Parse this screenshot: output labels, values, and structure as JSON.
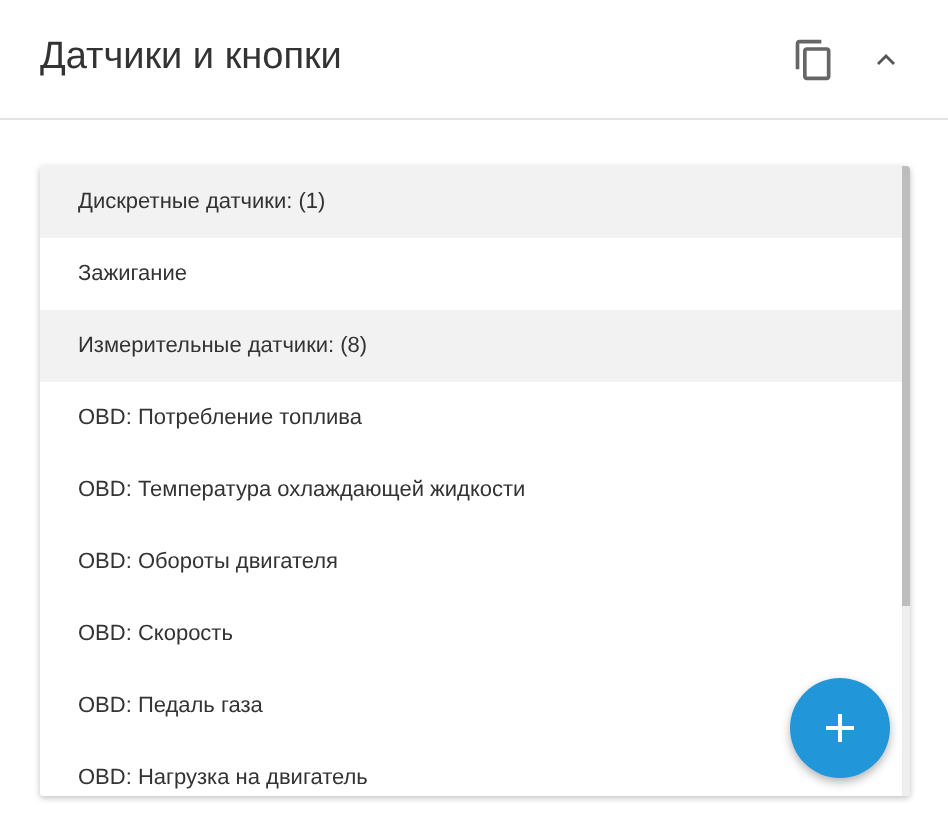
{
  "header": {
    "title": "Датчики и кнопки"
  },
  "list": [
    {
      "kind": "group",
      "label": "Дискретные датчики: (1)"
    },
    {
      "kind": "item",
      "label": "Зажигание"
    },
    {
      "kind": "group",
      "label": "Измерительные датчики: (8)"
    },
    {
      "kind": "item",
      "label": "OBD: Потребление топлива"
    },
    {
      "kind": "item",
      "label": "OBD: Температура охлаждающей жидкости"
    },
    {
      "kind": "item",
      "label": "OBD: Обороты двигателя"
    },
    {
      "kind": "item",
      "label": "OBD: Скорость"
    },
    {
      "kind": "item",
      "label": "OBD: Педаль газа"
    },
    {
      "kind": "item",
      "label": "OBD: Нагрузка на двигатель"
    }
  ]
}
